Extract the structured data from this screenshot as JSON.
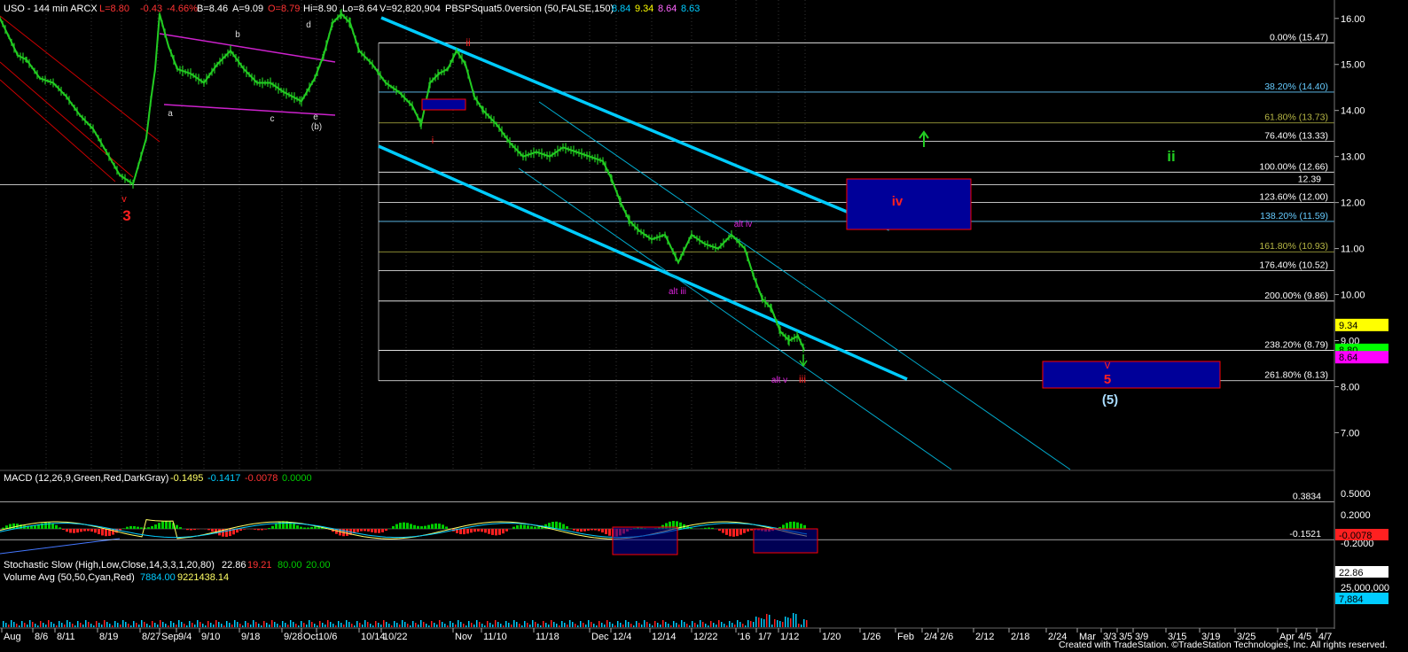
{
  "header": {
    "symbol_line": "USO - 144 min  ARCX",
    "last": "L=8.80",
    "change": "-0.43",
    "change_pct": "-4.66%",
    "bid": "B=8.46",
    "ask": "A=9.09",
    "open": "O=8.79",
    "hi": "Hi=8.90",
    "lo": "Lo=8.64",
    "volume": "V=92,820,904",
    "indicator": "PBSPSquat5.0version (50,FALSE,150)",
    "ind_values": [
      "8.84",
      "9.34",
      "8.64",
      "8.63"
    ]
  },
  "colors": {
    "bg": "#000000",
    "price": "#22cc22",
    "channel": "#00ccff",
    "fib_line": "#ffffff",
    "wave_red": "#ff2020",
    "wave_magenta": "#dd22dd",
    "wave_green": "#22cc22",
    "box_fill": "#000099",
    "box_edge": "#ff0000"
  },
  "chart_data": [
    {
      "type": "line",
      "title": "USO - 144 min  ARCX",
      "ylim": [
        6.2,
        16.4
      ],
      "y_ticks": [
        "16.00",
        "15.00",
        "14.00",
        "13.00",
        "12.00",
        "11.00",
        "10.00",
        "9.00",
        "8.00",
        "7.00"
      ],
      "x_ticks": [
        "Aug",
        "8/6",
        "8/11",
        "8/19",
        "8/27",
        "Sep",
        "9/4",
        "9/10",
        "9/18",
        "9/28",
        "Oct",
        "10/6",
        "10/14",
        "10/22",
        "Nov",
        "11/10",
        "11/18",
        "Dec",
        "12/4",
        "12/14",
        "12/22",
        "'16",
        "1/7",
        "1/12",
        "1/20",
        "1/26",
        "Feb",
        "2/4",
        "2/6",
        "2/12",
        "2/18",
        "2/24",
        "Mar",
        "3/3",
        "3/5",
        "3/9",
        "3/15",
        "3/19",
        "3/25",
        "Apr",
        "4/5",
        "4/7"
      ],
      "series": [
        {
          "x": [
            0,
            10,
            20,
            30,
            45,
            60,
            75,
            90,
            105,
            120,
            135,
            150,
            165,
            170,
            175,
            180,
            190,
            200,
            215,
            230,
            245,
            260,
            275,
            290,
            305,
            320,
            340,
            355,
            365,
            375,
            385,
            395,
            405,
            420,
            435,
            450,
            465,
            475,
            485,
            495,
            505,
            515,
            525,
            535,
            545,
            560,
            575,
            590,
            605,
            620,
            635,
            650,
            665,
            680,
            690,
            700,
            710,
            720,
            735,
            750,
            765,
            780,
            795,
            810,
            825,
            840,
            850,
            860,
            870,
            880,
            890,
            900,
            907
          ],
          "values": [
            16.0,
            15.6,
            15.2,
            15.1,
            14.7,
            14.6,
            14.3,
            13.9,
            13.6,
            13.1,
            12.6,
            12.4,
            13.4,
            14.2,
            14.9,
            16.1,
            15.4,
            14.9,
            14.8,
            14.6,
            15.0,
            15.3,
            14.9,
            14.6,
            14.6,
            14.4,
            14.2,
            14.7,
            15.2,
            15.9,
            16.1,
            15.9,
            15.3,
            15.0,
            14.6,
            14.4,
            14.1,
            13.7,
            14.6,
            14.8,
            14.9,
            15.3,
            15.0,
            14.3,
            14.0,
            13.7,
            13.3,
            13.0,
            13.1,
            13.0,
            13.2,
            13.1,
            13.0,
            12.9,
            12.5,
            12.0,
            11.6,
            11.4,
            11.2,
            11.3,
            10.7,
            11.3,
            11.1,
            11.0,
            11.3,
            11.0,
            10.4,
            9.9,
            9.7,
            9.2,
            9.0,
            9.1,
            8.8
          ],
          "name": ""
        }
      ],
      "fib_levels": [
        {
          "label": "0.00% (15.47)",
          "value": 15.47
        },
        {
          "label": "38.20% (14.40)",
          "value": 14.4
        },
        {
          "label": "61.80% (13.73)",
          "value": 13.73
        },
        {
          "label": "76.40% (13.33)",
          "value": 13.33
        },
        {
          "label": "100.00% (12.66)",
          "value": 12.66
        },
        {
          "label": "123.60% (12.00)",
          "value": 12.0
        },
        {
          "label": "138.20% (11.59)",
          "value": 11.59
        },
        {
          "label": "161.80% (10.93)",
          "value": 10.93
        },
        {
          "label": "176.40% (10.52)",
          "value": 10.52
        },
        {
          "label": "200.00% (9.86)",
          "value": 9.86
        },
        {
          "label": "238.20% (8.79)",
          "value": 8.79
        },
        {
          "label": "261.80% (8.13)",
          "value": 8.13
        }
      ],
      "horizontal_level": {
        "label": "12.39",
        "value": 12.39
      },
      "price_tags": [
        {
          "label": "9.34",
          "value": 9.34,
          "color": "#ffff00"
        },
        {
          "label": "8.80",
          "value": 8.8,
          "color": "#00ff00"
        },
        {
          "label": "8.64",
          "value": 8.64,
          "color": "#ff00ff"
        }
      ],
      "wave_labels": [
        "v",
        "3",
        "a",
        "b",
        "c",
        "d",
        "e",
        "(b)",
        "ii",
        "i",
        "alt iii",
        "alt iv",
        "alt v",
        "iii",
        "iv",
        "ii",
        "v",
        "5",
        "(5)"
      ]
    },
    {
      "type": "line",
      "title": "MACD (12,26,9,Green,Red,DarkGray)",
      "values_shown": [
        "-0.1495",
        "-0.1417",
        "-0.0078",
        "0.0000"
      ],
      "y_ticks": [
        "0.5000",
        "0.2000",
        "-0.2000"
      ],
      "levels": [
        "0.3834",
        "-0.1521"
      ],
      "price_tag": "-0.0078"
    },
    {
      "type": "line",
      "title": "Stochastic Slow (High,Low,Close,14,3,3,1,20,80)",
      "values_shown": [
        "22.86",
        "19.21",
        "80.00",
        "20.00"
      ],
      "price_tag": "22.86"
    },
    {
      "type": "bar",
      "title": "Volume Avg (50,50,Cyan,Red)",
      "values_shown": [
        "7884.00",
        "9221438.14"
      ],
      "y_ticks": [
        "25,000,000"
      ],
      "price_tag": "7,884"
    }
  ],
  "footer": "Created with TradeStation. ©TradeStation Technologies, Inc. All rights reserved."
}
